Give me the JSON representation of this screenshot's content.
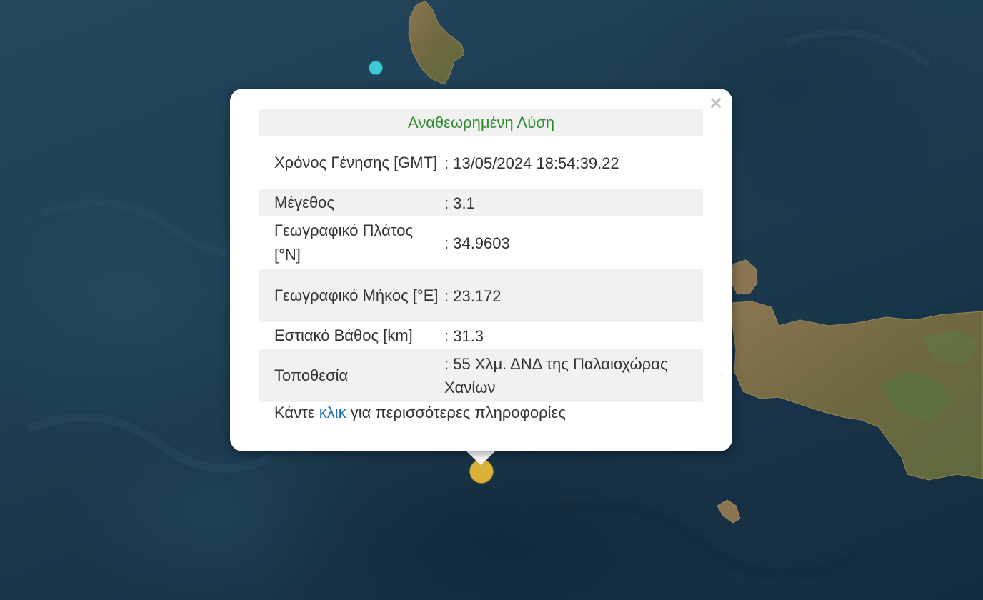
{
  "popup": {
    "close_symbol": "×",
    "title": "Αναθεωρημένη Λύση",
    "rows": [
      {
        "label": "Χρόνος Γένησης [GMT]",
        "value": ": 13/05/2024 18:54:39.22"
      },
      {
        "label": "Μέγεθος",
        "value": ": 3.1"
      },
      {
        "label": "Γεωγραφικό Πλάτος [°N]",
        "value": ": 34.9603"
      },
      {
        "label": "Γεωγραφικό Μήκος [°E]",
        "value": ": 23.172"
      },
      {
        "label": "Εστιακό Βάθος [km]",
        "value": ": 31.3"
      },
      {
        "label": "Τοποθεσία",
        "value": ": 55 Χλμ. ΔΝΔ της Παλαιοχώρας Χανίων"
      }
    ],
    "footer": {
      "before": "Κάντε ",
      "link": "κλικ",
      "after": " για περισσότερες πληροφορίες"
    }
  },
  "colors": {
    "sea": "#1e3d52",
    "land": "#7a6a45",
    "marker_main": "#d9b23a",
    "marker_small": "#3ec9d6",
    "title_green": "#2e8b2e",
    "link_blue": "#1a73b8"
  }
}
